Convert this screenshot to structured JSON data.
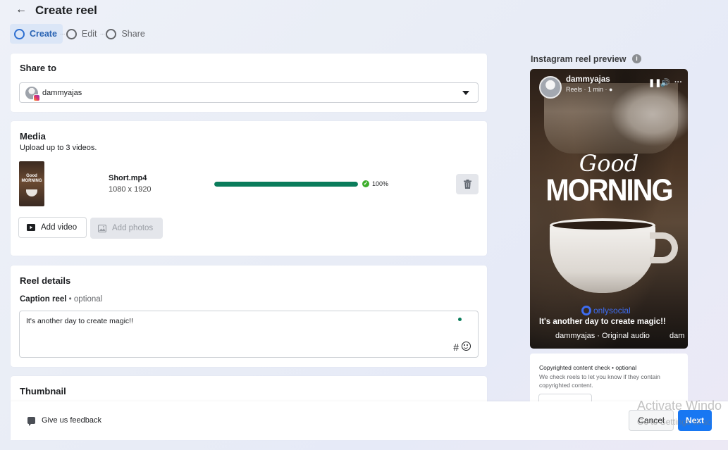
{
  "header": {
    "title": "Create reel",
    "back_icon": "arrow-left-icon"
  },
  "steps": [
    {
      "label": "Create",
      "active": true
    },
    {
      "label": "Edit",
      "active": false
    },
    {
      "label": "Share",
      "active": false
    }
  ],
  "share_to": {
    "title": "Share to",
    "account": "dammyajas"
  },
  "media": {
    "title": "Media",
    "subtitle": "Upload up to 3 videos.",
    "file_name": "Short.mp4",
    "file_dims": "1080 x 1920",
    "progress_percent": 100,
    "progress_label": "100%",
    "add_video": "Add video",
    "add_photos": "Add photos"
  },
  "details": {
    "title": "Reel details",
    "caption_label": "Caption reel",
    "caption_optional": "optional",
    "caption_value": "It's another day to create magic!!"
  },
  "thumbnail": {
    "title": "Thumbnail"
  },
  "preview": {
    "title": "Instagram reel preview",
    "username": "dammyajas",
    "meta": "Reels · 1 min ·",
    "good": "Good",
    "morning": "MORNING",
    "brand": "onlysocial",
    "caption": "It's another day to create magic!!",
    "audio": "dammyajas · Original audio",
    "audio_repeat": "dam"
  },
  "copyright": {
    "title": "Copyrighted content check • optional",
    "description": "We check reels to let you know if they contain copyrighted content."
  },
  "footer": {
    "feedback": "Give us feedback",
    "cancel": "Cancel",
    "next": "Next"
  },
  "watermark": {
    "line1": "Activate Windo",
    "line2": "Go to Settings to ac"
  },
  "colors": {
    "accent": "#1877f2",
    "progress": "#0a7c5b",
    "step_active_bg": "#dbe6f7"
  }
}
